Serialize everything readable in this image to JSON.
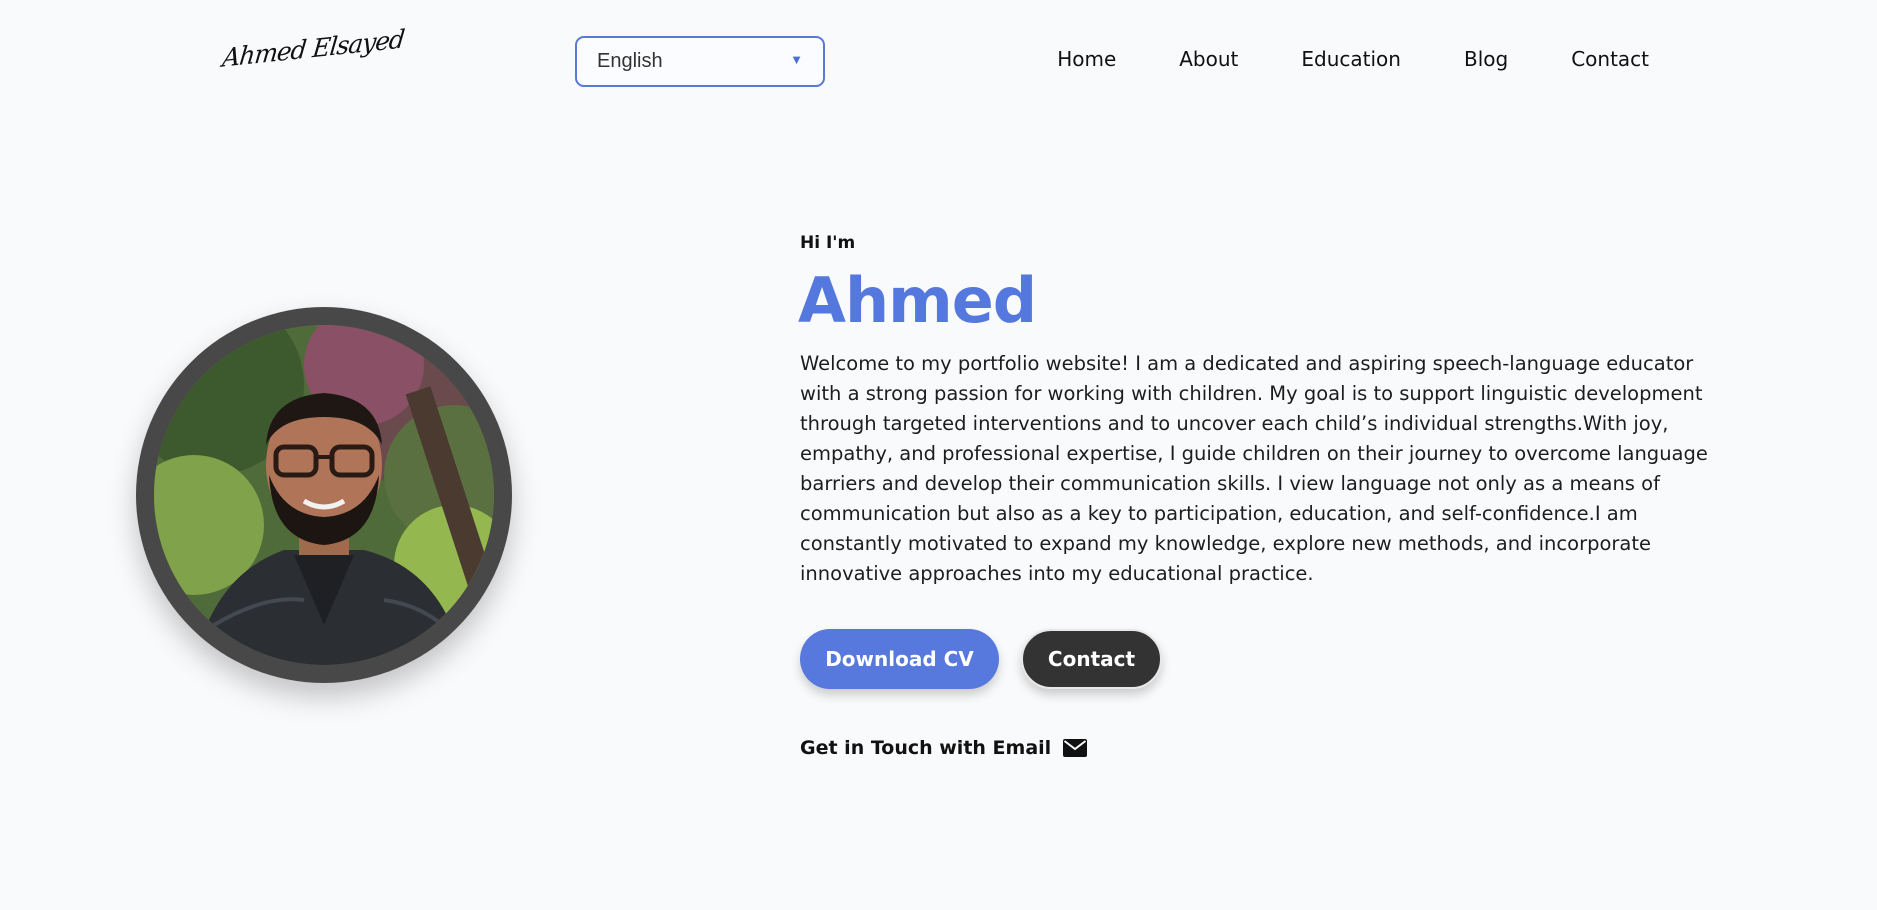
{
  "header": {
    "logo_text": "Ahmed Elsayed",
    "language": {
      "selected": "English",
      "chevron_icon": "triangle-down-icon"
    },
    "nav": [
      {
        "label": "Home"
      },
      {
        "label": "About"
      },
      {
        "label": "Education"
      },
      {
        "label": "Blog"
      },
      {
        "label": "Contact"
      }
    ]
  },
  "hero": {
    "greeting": "Hi I'm",
    "name": "Ahmed",
    "bio": "Welcome to my portfolio website! I am a dedicated and aspiring speech-language educator with a strong passion for working with children. My goal is to support linguistic development through targeted interventions and to uncover each child’s individual strengths.With joy, empathy, and professional expertise, I guide children on their journey to overcome language barriers and develop their communication skills. I view language not only as a means of communication but also as a key to participation, education, and self-confidence.I am constantly motivated to expand my knowledge, explore new methods, and incorporate innovative approaches into my educational practice.",
    "buttons": {
      "download_cv": "Download CV",
      "contact": "Contact"
    },
    "email_cta": {
      "label": "Get in Touch with Email",
      "icon": "envelope-icon"
    },
    "avatar": {
      "kind": "profile-photo"
    }
  },
  "colors": {
    "accent": "#5478dd",
    "background": "#f9fafc",
    "dark_button": "#333333",
    "avatar_ring": "#484848"
  }
}
